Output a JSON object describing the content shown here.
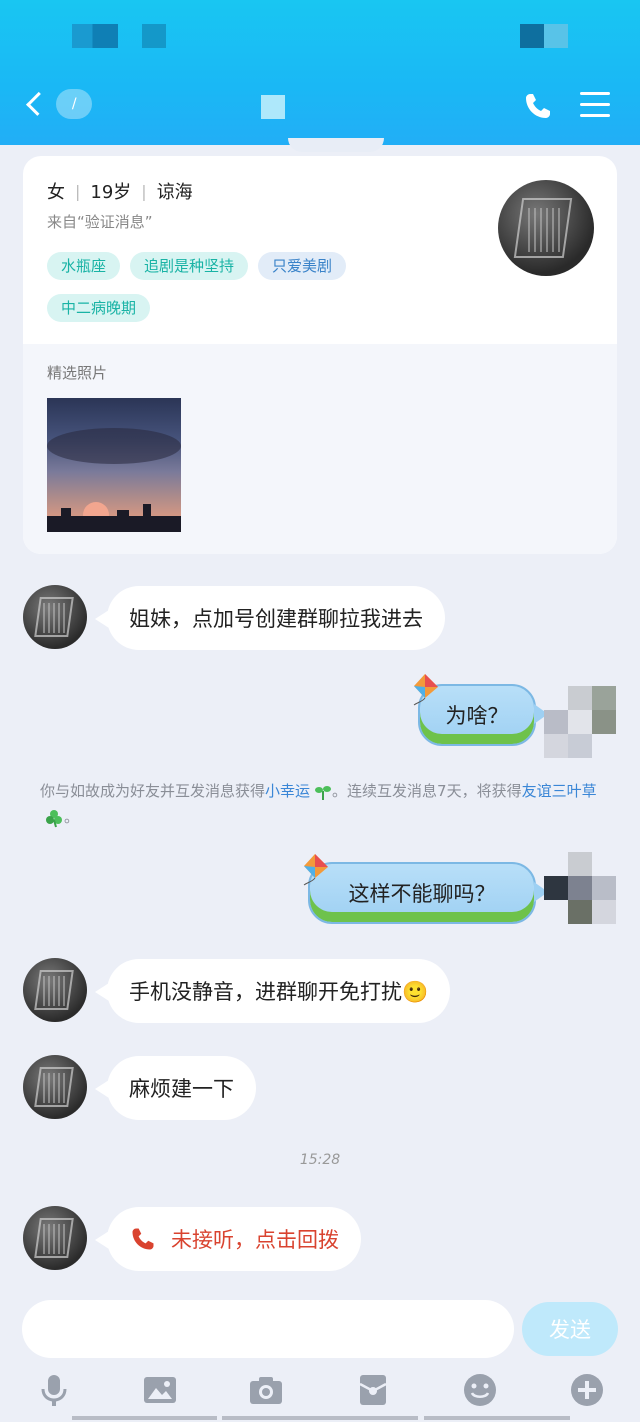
{
  "header": {
    "back_badge": "/",
    "colors": {
      "header_bg": "#1ab8f5",
      "accent": "#3a86d6"
    }
  },
  "profile": {
    "gender": "女",
    "age": "19岁",
    "location": "谅海",
    "source": "来自“验证消息”",
    "tags": [
      "水瓶座",
      "追剧是种坚持",
      "只爱美剧",
      "中二病晚期"
    ],
    "photos_label": "精选照片"
  },
  "messages": [
    {
      "side": "left",
      "text": "姐妹，点加号创建群聊拉我进去"
    },
    {
      "side": "right",
      "text": "为啥？"
    },
    {
      "side": "right",
      "text": "这样不能聊吗？"
    },
    {
      "side": "left",
      "text": "手机没静音，进群聊开免打扰🙂"
    },
    {
      "side": "left",
      "text": "麻烦建一下"
    },
    {
      "side": "left",
      "text": "未接听，点击回拨",
      "type": "missed_call"
    }
  ],
  "system": {
    "part1": "你与如故成为好友并互发消息获得",
    "link1": "小幸运",
    "part2": "。连续互发消息7天，将获得",
    "link2": "友谊三叶草",
    "part3": "。"
  },
  "timestamp": "15:28",
  "composer": {
    "placeholder": "",
    "send_label": "发送"
  },
  "toolbar": {
    "icons": [
      "microphone-icon",
      "image-icon",
      "camera-icon",
      "red-packet-icon",
      "emoji-icon",
      "plus-icon"
    ]
  }
}
